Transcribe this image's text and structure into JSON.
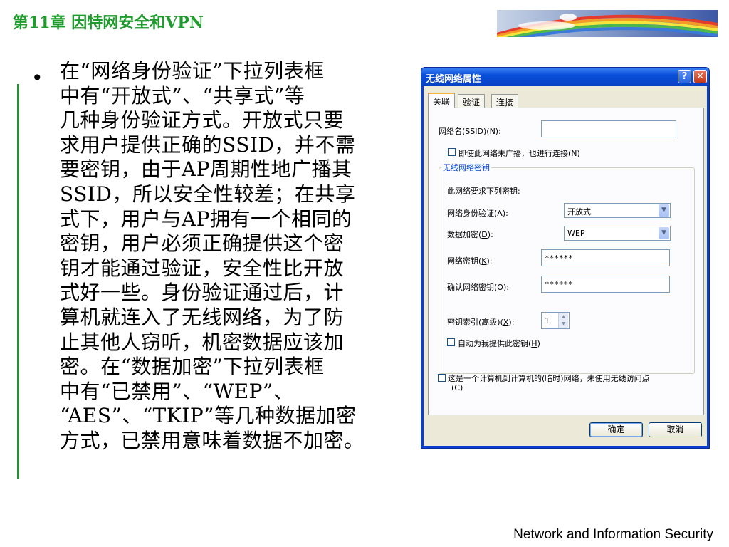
{
  "slide": {
    "chapter_title": "第11章 因特网安全和VPN",
    "footer": "Network and Information Security",
    "bullet": "•",
    "body_lines": [
      "在“网络身份验证”下拉列表框",
      "中有“开放式”、“共享式”等",
      "几种身份验证方式。开放式只要",
      "求用户提供正确的SSID，并不需",
      "要密钥，由于AP周期性地广播其",
      "SSID，所以安全性较差；在共享",
      "式下，用户与AP拥有一个相同的",
      "密钥，用户必须正确提供这个密",
      "钥才能通过验证，安全性比开放",
      "式好一些。身份验证通过后，计",
      "算机就连入了无线网络，为了防",
      "止其他人窃听，机密数据应该加",
      "密。在“数据加密”下拉列表框",
      "中有“已禁用”、“WEP”、",
      "“AES”、“TKIP”等几种数据加密",
      "方式，已禁用意味着数据不加密。"
    ],
    "accent_color": "#1f9a2c"
  },
  "dialog": {
    "title": "无线网络属性",
    "help_glyph": "?",
    "close_glyph": "✕",
    "tabs": [
      "关联",
      "验证",
      "连接"
    ],
    "ssid_label_pre": "网络名(SSID)(",
    "ssid_label_key": "N",
    "ssid_label_post": "):",
    "ssid_value": "",
    "broadcast_label_pre": "即使此网络未广播，也进行连接(",
    "broadcast_label_key": "N",
    "broadcast_label_post": ")",
    "group_title": "无线网络密钥",
    "requires_key_text": "此网络要求下列密钥:",
    "auth_label_pre": "网络身份验证(",
    "auth_label_key": "A",
    "auth_label_post": "):",
    "auth_value": "开放式",
    "enc_label_pre": "数据加密(",
    "enc_label_key": "D",
    "enc_label_post": "):",
    "enc_value": "WEP",
    "netkey_label_pre": "网络密钥(",
    "netkey_label_key": "K",
    "netkey_label_post": "):",
    "netkey_value": "******",
    "confirm_label_pre": "确认网络密钥(",
    "confirm_label_key": "O",
    "confirm_label_post": "):",
    "confirm_value": "******",
    "keyindex_label_pre": "密钥索引(高级)(",
    "keyindex_label_key": "X",
    "keyindex_label_post": "):",
    "keyindex_value": "1",
    "autokey_label_pre": "自动为我提供此密钥(",
    "autokey_label_key": "H",
    "autokey_label_post": ")",
    "adhoc_label_line1": "这是一个计算机到计算机的(临时)网络，未使用无线访问点",
    "adhoc_label_line2": "(C)",
    "ok_label": "确定",
    "cancel_label": "取消"
  }
}
